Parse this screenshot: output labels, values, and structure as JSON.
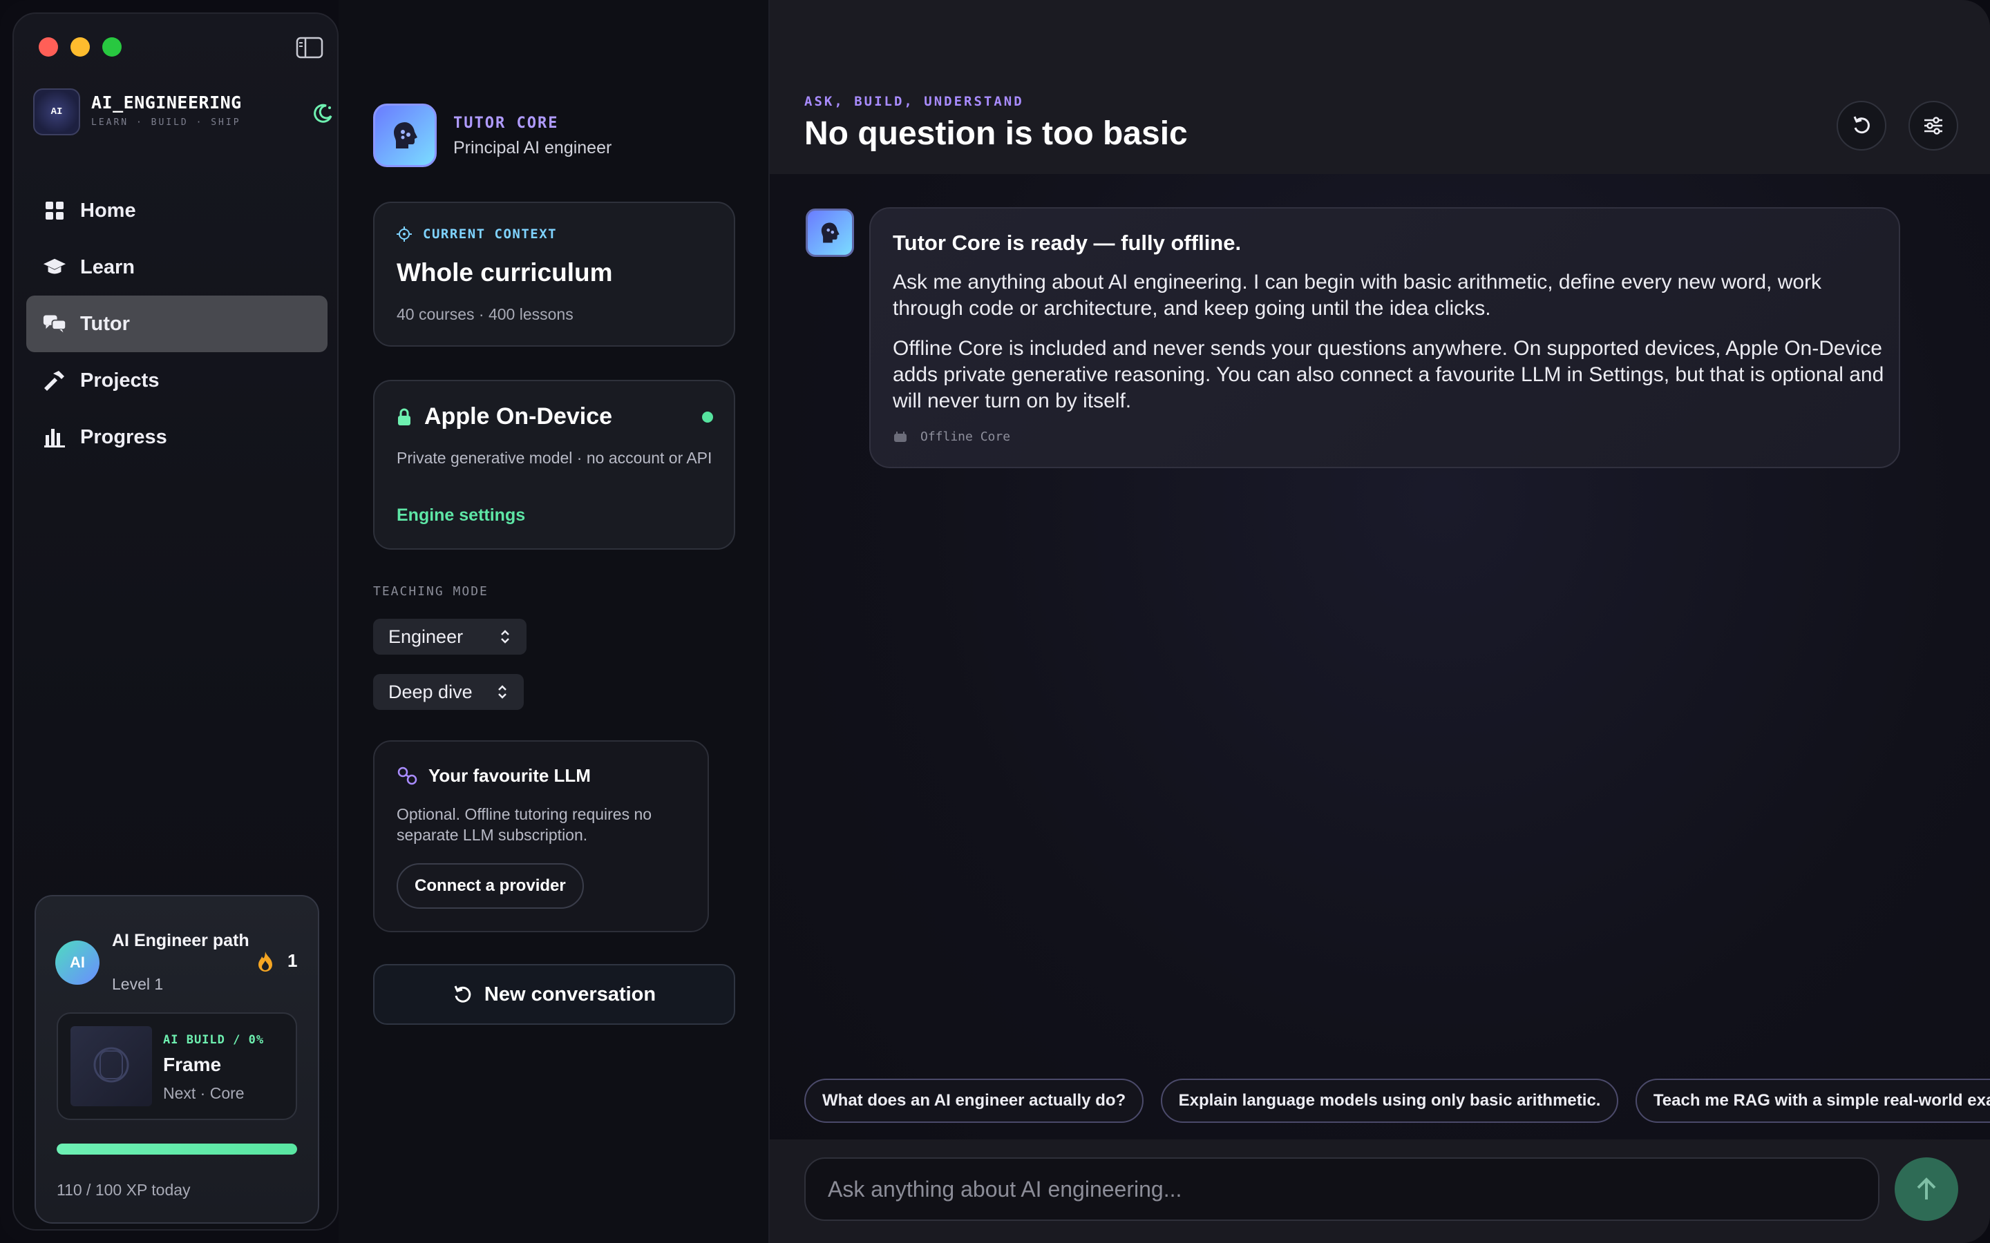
{
  "window": {
    "controls": [
      "close",
      "minimize",
      "zoom"
    ]
  },
  "brand": {
    "logo_text": "AI",
    "name": "AI_ENGINEERING",
    "tagline": "LEARN · BUILD · SHIP"
  },
  "nav": {
    "items": [
      {
        "label": "Home",
        "icon": "grid-icon"
      },
      {
        "label": "Learn",
        "icon": "graduation-cap-icon"
      },
      {
        "label": "Tutor",
        "icon": "chat-bubbles-icon",
        "active": true
      },
      {
        "label": "Projects",
        "icon": "hammer-icon"
      },
      {
        "label": "Progress",
        "icon": "bar-chart-icon"
      }
    ]
  },
  "progress_card": {
    "avatar_text": "AI",
    "path_title": "AI Engineer path",
    "level": "Level 1",
    "streak": "1",
    "next": {
      "tag": "AI BUILD / 0%",
      "title": "Frame",
      "subtitle": "Next · Core"
    },
    "xp_fraction": 1.0,
    "xp_label": "110 / 100 XP today"
  },
  "tutor": {
    "kicker": "TUTOR CORE",
    "role": "Principal AI engineer",
    "context": {
      "kicker": "CURRENT CONTEXT",
      "title": "Whole curriculum",
      "subtitle": "40 courses · 400 lessons"
    },
    "engine": {
      "title": "Apple On-Device",
      "description": "Private generative model · no account or API",
      "link": "Engine settings",
      "status_color": "#56e39f"
    },
    "teaching_mode_label": "TEACHING MODE",
    "mode_select": "Engineer",
    "depth_select": "Deep dive",
    "llm": {
      "title": "Your favourite LLM",
      "description": "Optional. Offline tutoring requires no separate LLM subscription.",
      "button": "Connect a provider"
    },
    "new_conversation": "New conversation"
  },
  "main": {
    "kicker": "ASK, BUILD, UNDERSTAND",
    "title": "No question is too basic",
    "message": {
      "title": "Tutor Core is ready — fully offline.",
      "p1": "Ask me anything about AI engineering. I can begin with basic arithmetic, define every new word, work through code or architecture, and keep going until the idea clicks.",
      "p2": "Offline Core is included and never sends your questions anywhere. On supported devices, Apple On-Device adds private generative reasoning. You can also connect a favourite LLM in Settings, but that is optional and will never turn on by itself.",
      "source": "Offline Core"
    },
    "suggestions": [
      "What does an AI engineer actually do?",
      "Explain language models using only basic arithmetic.",
      "Teach me RAG with a simple real-world example"
    ],
    "composer_placeholder": "Ask anything about AI engineering..."
  },
  "colors": {
    "accent_green": "#5ee6a6",
    "accent_purple": "#a98cff",
    "accent_blue": "#7fd3ff"
  }
}
